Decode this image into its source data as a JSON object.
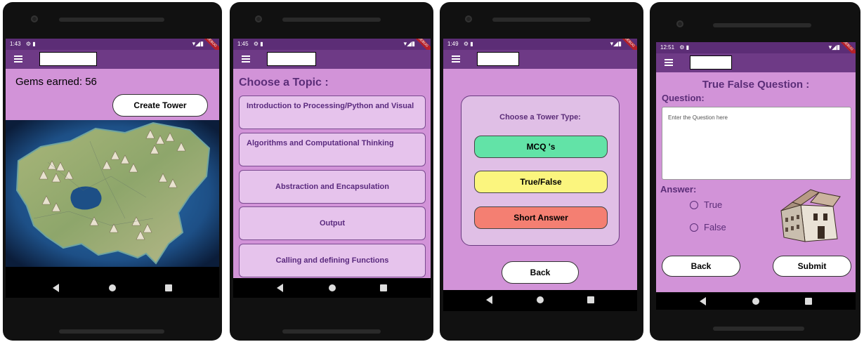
{
  "screens": [
    {
      "status_time": "1:43",
      "gems_label": "Gems earned: 56",
      "create_tower_label": "Create Tower"
    },
    {
      "status_time": "1:45",
      "title": "Choose a Topic :",
      "topics": [
        "Introduction to Processing/Python and Visual",
        "Algorithms and Computational Thinking",
        "Abstraction and Encapsulation",
        "Output",
        "Calling and defining Functions"
      ]
    },
    {
      "status_time": "1:49",
      "prompt": "Choose a Tower Type:",
      "options": [
        "MCQ 's",
        "True/False",
        "Short Answer"
      ],
      "back_label": "Back"
    },
    {
      "status_time": "12:51",
      "title": "True False Question :",
      "question_label": "Question:",
      "question_placeholder": "Enter the Question here",
      "answer_label": "Answer:",
      "answer_options": [
        "True",
        "False"
      ],
      "back_label": "Back",
      "submit_label": "Submit"
    }
  ],
  "status_icons": "⚙ ▮",
  "status_right": "▾◢▮",
  "debug_label": "DEBUG",
  "colors": {
    "statusbar": "#5c2d76",
    "appbar": "#6e3a86",
    "background": "#d293d8",
    "mcq": "#62e3a7",
    "truefalse": "#fbf57e",
    "shortanswer": "#f47f72",
    "title_text": "#5b2d78"
  }
}
